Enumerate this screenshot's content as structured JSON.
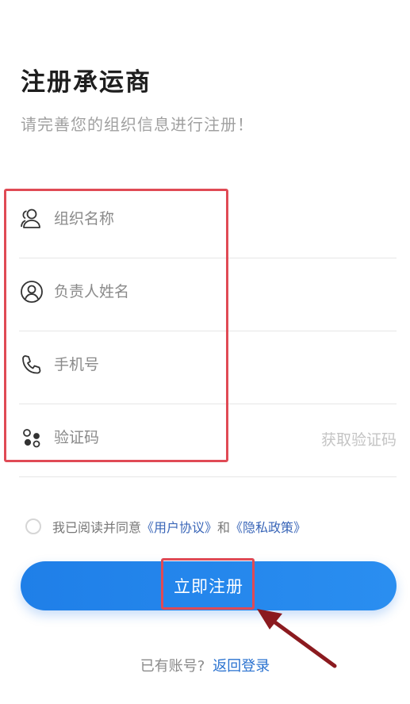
{
  "header": {
    "title": "注册承运商",
    "subtitle": "请完善您的组织信息进行注册！"
  },
  "form": {
    "org_name": {
      "placeholder": "组织名称",
      "value": ""
    },
    "contact_name": {
      "placeholder": "负责人姓名",
      "value": ""
    },
    "phone": {
      "placeholder": "手机号",
      "value": ""
    },
    "code": {
      "placeholder": "验证码",
      "value": ""
    },
    "get_code_label": "获取验证码"
  },
  "agreement": {
    "prefix": "我已阅读并同意",
    "user_agreement": "《用户协议》",
    "and": "和",
    "privacy_policy": "《隐私政策》",
    "checked": false
  },
  "register_button": {
    "label": "立即注册"
  },
  "login_row": {
    "text": "已有账号?",
    "link": "返回登录"
  },
  "colors": {
    "primary": "#2a8ef0",
    "link": "#3a66b8",
    "highlight": "#e04a55",
    "arrow": "#8b1a1f"
  },
  "icons": [
    "user-group-icon",
    "user-circle-icon",
    "phone-icon",
    "verification-dots-icon"
  ]
}
